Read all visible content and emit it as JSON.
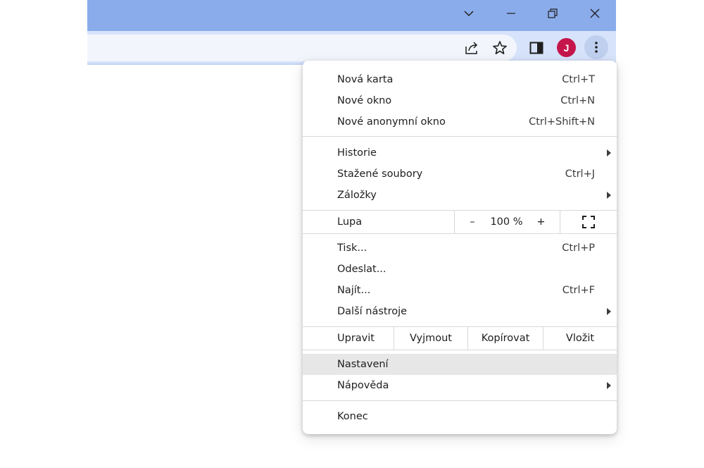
{
  "window": {
    "avatar_letter": "J",
    "avatar_color": "#c5164c",
    "titlebar_color": "#8aaceb",
    "toolbar_color": "#d7e3fb"
  },
  "menu": {
    "new_tab": {
      "label": "Nová karta",
      "shortcut": "Ctrl+T"
    },
    "new_window": {
      "label": "Nové okno",
      "shortcut": "Ctrl+N"
    },
    "new_incognito": {
      "label": "Nové anonymní okno",
      "shortcut": "Ctrl+Shift+N"
    },
    "history": {
      "label": "Historie"
    },
    "downloads": {
      "label": "Stažené soubory",
      "shortcut": "Ctrl+J"
    },
    "bookmarks": {
      "label": "Záložky"
    },
    "zoom": {
      "label": "Lupa",
      "minus": "–",
      "value": "100 %",
      "plus": "+"
    },
    "print": {
      "label": "Tisk...",
      "shortcut": "Ctrl+P"
    },
    "cast": {
      "label": "Odeslat..."
    },
    "find": {
      "label": "Najít...",
      "shortcut": "Ctrl+F"
    },
    "more_tools": {
      "label": "Další nástroje"
    },
    "edit": {
      "label": "Upravit",
      "cut": "Vyjmout",
      "copy": "Kopírovat",
      "paste": "Vložit"
    },
    "settings": {
      "label": "Nastavení"
    },
    "help": {
      "label": "Nápověda"
    },
    "exit": {
      "label": "Konec"
    }
  }
}
